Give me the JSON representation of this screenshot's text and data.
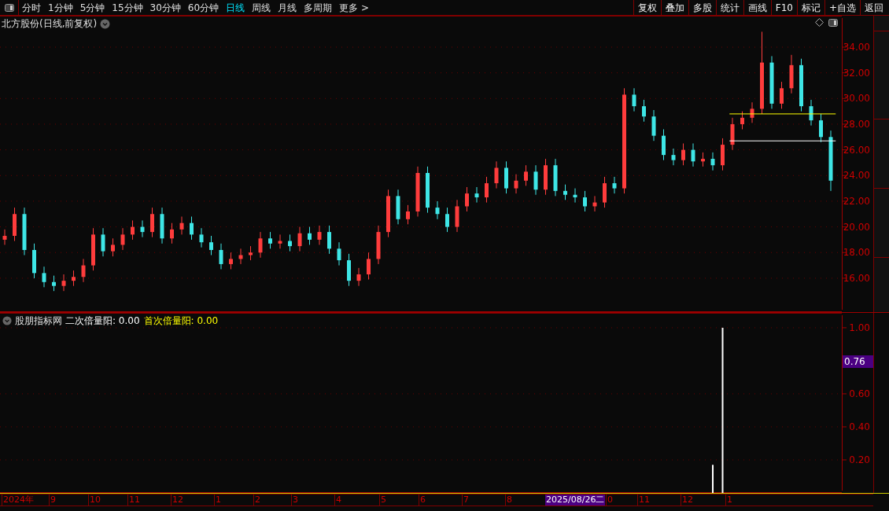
{
  "toolbar": {
    "periods": [
      {
        "label": "分时",
        "selected": false
      },
      {
        "label": "1分钟",
        "selected": false
      },
      {
        "label": "5分钟",
        "selected": false
      },
      {
        "label": "15分钟",
        "selected": false
      },
      {
        "label": "30分钟",
        "selected": false
      },
      {
        "label": "60分钟",
        "selected": false
      },
      {
        "label": "日线",
        "selected": true
      },
      {
        "label": "周线",
        "selected": false
      },
      {
        "label": "月线",
        "selected": false
      },
      {
        "label": "多周期",
        "selected": false
      },
      {
        "label": "更多 >",
        "selected": false
      }
    ],
    "actions": [
      "复权",
      "叠加",
      "多股",
      "统计",
      "画线",
      "F10",
      "标记",
      "+自选",
      "返回"
    ]
  },
  "price_panel": {
    "title": "北方股份(日线,前复权)",
    "chart_data": {
      "type": "candlestick",
      "grid": true,
      "ylim": [
        13.36,
        36.45
      ],
      "yticks": [
        {
          "value": 16,
          "label": "16.00"
        },
        {
          "value": 18,
          "label": "18.00"
        },
        {
          "value": 20,
          "label": "20.00"
        },
        {
          "value": 22,
          "label": "22.00"
        },
        {
          "value": 24,
          "label": "24.00"
        },
        {
          "value": 26,
          "label": "26.00"
        },
        {
          "value": 28,
          "label": "28.00"
        },
        {
          "value": 30,
          "label": "30.00"
        },
        {
          "value": 32,
          "label": "32.00"
        },
        {
          "value": 34,
          "label": "34.00"
        }
      ],
      "categories": [
        null,
        null,
        null,
        null,
        null,
        null,
        null,
        null,
        null,
        null,
        null,
        null,
        null,
        null,
        null,
        null,
        null,
        null,
        null,
        null,
        null,
        null,
        null,
        null,
        null,
        null,
        null,
        null,
        null,
        null,
        null,
        null,
        null,
        null,
        null,
        null,
        null,
        null,
        null,
        null,
        null,
        null,
        null,
        null,
        null,
        null,
        null,
        null,
        null,
        null,
        null,
        null,
        null,
        null,
        null,
        null,
        null,
        null,
        null,
        null,
        null,
        null,
        null,
        null,
        null,
        null,
        null,
        null,
        null,
        null,
        null,
        null,
        null,
        null,
        null,
        null,
        null,
        null,
        null,
        null,
        null,
        null,
        null,
        null,
        null
      ],
      "ohlc": [
        [
          19.0,
          19.8,
          18.6,
          19.3
        ],
        [
          19.3,
          21.5,
          18.9,
          21.0
        ],
        [
          21.0,
          21.5,
          17.8,
          18.2
        ],
        [
          18.2,
          18.7,
          16.0,
          16.4
        ],
        [
          16.4,
          16.9,
          15.3,
          15.7
        ],
        [
          15.7,
          16.2,
          15.0,
          15.4
        ],
        [
          15.4,
          16.3,
          15.0,
          15.8
        ],
        [
          15.8,
          16.6,
          15.4,
          16.1
        ],
        [
          16.1,
          17.5,
          15.7,
          17.0
        ],
        [
          17.0,
          19.9,
          16.6,
          19.4
        ],
        [
          19.4,
          19.9,
          17.7,
          18.1
        ],
        [
          18.1,
          19.1,
          17.7,
          18.6
        ],
        [
          18.6,
          19.9,
          18.2,
          19.4
        ],
        [
          19.4,
          20.5,
          19.0,
          20.0
        ],
        [
          20.0,
          20.5,
          19.2,
          19.6
        ],
        [
          19.6,
          21.5,
          19.2,
          21.0
        ],
        [
          21.0,
          21.5,
          18.7,
          19.1
        ],
        [
          19.1,
          20.3,
          18.7,
          19.8
        ],
        [
          19.8,
          20.8,
          19.4,
          20.3
        ],
        [
          20.3,
          20.8,
          19.0,
          19.4
        ],
        [
          19.4,
          19.9,
          18.4,
          18.8
        ],
        [
          18.8,
          19.3,
          17.8,
          18.2
        ],
        [
          18.2,
          18.7,
          16.7,
          17.1
        ],
        [
          17.1,
          18.0,
          16.7,
          17.5
        ],
        [
          17.5,
          18.3,
          17.1,
          17.8
        ],
        [
          17.8,
          18.5,
          17.4,
          18.0
        ],
        [
          18.0,
          19.6,
          17.6,
          19.1
        ],
        [
          19.1,
          19.6,
          18.3,
          18.7
        ],
        [
          18.7,
          19.4,
          18.3,
          18.9
        ],
        [
          18.9,
          19.4,
          18.1,
          18.5
        ],
        [
          18.5,
          20.0,
          18.1,
          19.5
        ],
        [
          19.5,
          20.0,
          18.6,
          19.0
        ],
        [
          19.0,
          20.1,
          18.6,
          19.6
        ],
        [
          19.6,
          20.1,
          17.9,
          18.3
        ],
        [
          18.3,
          18.8,
          17.0,
          17.4
        ],
        [
          17.4,
          17.9,
          15.4,
          15.8
        ],
        [
          15.8,
          16.8,
          15.4,
          16.3
        ],
        [
          16.3,
          18.0,
          15.9,
          17.5
        ],
        [
          17.5,
          20.1,
          17.1,
          19.6
        ],
        [
          19.6,
          22.9,
          19.2,
          22.4
        ],
        [
          22.4,
          22.9,
          20.2,
          20.6
        ],
        [
          20.6,
          21.7,
          20.2,
          21.2
        ],
        [
          21.2,
          24.7,
          20.8,
          24.2
        ],
        [
          24.2,
          24.7,
          21.1,
          21.5
        ],
        [
          21.5,
          22.0,
          20.6,
          21.0
        ],
        [
          21.0,
          21.5,
          19.6,
          20.0
        ],
        [
          20.0,
          22.1,
          19.6,
          21.6
        ],
        [
          21.6,
          23.1,
          21.2,
          22.6
        ],
        [
          22.6,
          23.1,
          21.9,
          22.3
        ],
        [
          22.3,
          23.9,
          21.9,
          23.4
        ],
        [
          23.4,
          25.1,
          23.0,
          24.6
        ],
        [
          24.6,
          25.1,
          22.6,
          23.0
        ],
        [
          23.0,
          24.1,
          22.6,
          23.6
        ],
        [
          23.6,
          24.8,
          23.2,
          24.3
        ],
        [
          24.3,
          24.8,
          22.5,
          22.9
        ],
        [
          22.9,
          25.3,
          22.5,
          24.8
        ],
        [
          24.8,
          25.3,
          22.4,
          22.8
        ],
        [
          22.8,
          23.3,
          22.1,
          22.5
        ],
        [
          22.5,
          23.0,
          21.9,
          22.3
        ],
        [
          22.3,
          22.8,
          21.2,
          21.6
        ],
        [
          21.6,
          22.4,
          21.2,
          21.9
        ],
        [
          21.9,
          23.9,
          21.5,
          23.4
        ],
        [
          23.4,
          23.9,
          22.6,
          23.0
        ],
        [
          23.0,
          30.8,
          22.6,
          30.3
        ],
        [
          30.3,
          30.8,
          29.0,
          29.4
        ],
        [
          29.4,
          29.9,
          28.2,
          28.6
        ],
        [
          28.6,
          29.1,
          26.7,
          27.1
        ],
        [
          27.1,
          27.6,
          25.2,
          25.6
        ],
        [
          25.6,
          26.1,
          24.8,
          25.2
        ],
        [
          25.2,
          26.5,
          24.8,
          26.0
        ],
        [
          26.0,
          26.5,
          24.7,
          25.1
        ],
        [
          25.1,
          25.8,
          24.7,
          25.3
        ],
        [
          25.3,
          25.8,
          24.4,
          24.8
        ],
        [
          24.8,
          26.9,
          24.4,
          26.4
        ],
        [
          26.4,
          28.5,
          26.0,
          28.0
        ],
        [
          28.0,
          29.0,
          27.6,
          28.5
        ],
        [
          28.5,
          29.7,
          28.1,
          29.2
        ],
        [
          29.2,
          35.2,
          28.8,
          32.8
        ],
        [
          32.8,
          33.3,
          29.2,
          29.6
        ],
        [
          29.6,
          31.3,
          29.2,
          30.8
        ],
        [
          30.8,
          33.4,
          30.4,
          32.6
        ],
        [
          32.6,
          33.1,
          29.0,
          29.4
        ],
        [
          29.4,
          29.9,
          27.9,
          28.3
        ],
        [
          28.3,
          28.8,
          26.6,
          27.0
        ],
        [
          27.0,
          27.5,
          22.8,
          23.6
        ]
      ],
      "ref_lines": [
        {
          "axis": "y",
          "value": 28.8,
          "color": "#ffff00"
        },
        {
          "axis": "y",
          "value": 26.7,
          "color": "#ffffff"
        }
      ]
    }
  },
  "indicator_panel": {
    "name": "股朋指标网",
    "items": [
      {
        "label": "二次倍量阳: 0.00",
        "color": "#ffffff"
      },
      {
        "label": "首次倍量阳: 0.00",
        "color": "#ffff00"
      }
    ],
    "cursor_value": "0.76",
    "chart_data": {
      "type": "bar",
      "grid": true,
      "ylim": [
        0,
        1.09
      ],
      "yticks": [
        {
          "value": 0.2,
          "label": "0.20"
        },
        {
          "value": 0.4,
          "label": "0.40"
        },
        {
          "value": 0.6,
          "label": "0.60"
        },
        {
          "value": 1.0,
          "label": "1.00"
        }
      ],
      "values": [
        null,
        null,
        null,
        null,
        null,
        null,
        null,
        null,
        null,
        null,
        null,
        null,
        null,
        null,
        null,
        null,
        null,
        null,
        null,
        null,
        null,
        null,
        null,
        null,
        null,
        null,
        null,
        null,
        null,
        null,
        null,
        null,
        null,
        null,
        null,
        null,
        null,
        null,
        null,
        null,
        null,
        null,
        null,
        null,
        null,
        null,
        null,
        null,
        null,
        null,
        null,
        null,
        null,
        null,
        null,
        null,
        null,
        null,
        null,
        null,
        null,
        null,
        null,
        null,
        null,
        null,
        null,
        null,
        null,
        null,
        null,
        null,
        0.17,
        1.0,
        null,
        null,
        null,
        null,
        null,
        null,
        null,
        null,
        null,
        null,
        null
      ]
    }
  },
  "date_axis": [
    "2024年",
    "9",
    "10",
    "11",
    "12",
    "1",
    "2",
    "3",
    "4",
    "5",
    "6",
    "7",
    "8",
    "0",
    "11",
    "12",
    "1"
  ],
  "cursor_date": "2025/08/26二"
}
